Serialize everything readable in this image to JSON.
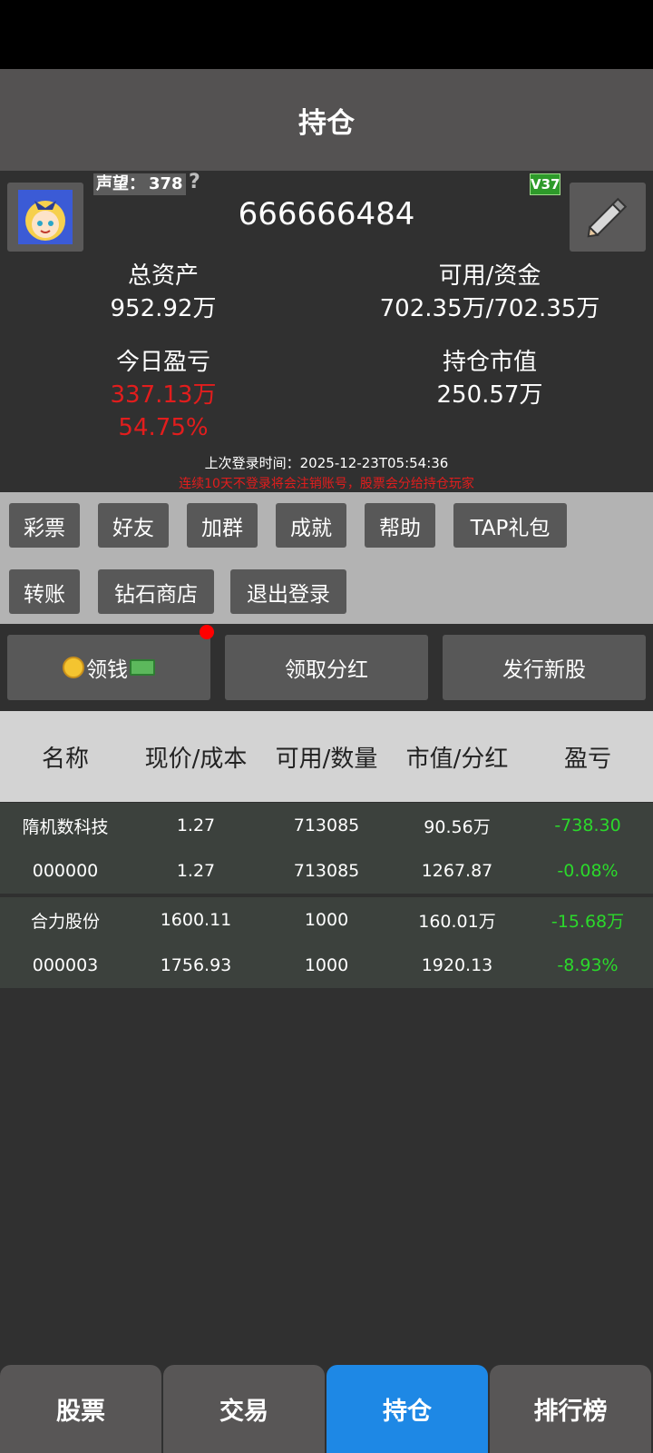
{
  "header": {
    "title": "持仓"
  },
  "account": {
    "prestige_label": "声望：",
    "prestige_value": "378",
    "help_mark": "?",
    "vip": "V37",
    "id": "666666484"
  },
  "stats": {
    "total_assets_label": "总资产",
    "total_assets": "952.92万",
    "available_label": "可用/资金",
    "available": "702.35万/702.35万",
    "today_pl_label": "今日盈亏",
    "today_pl": "337.13万",
    "today_pl_pct": "54.75%",
    "market_value_label": "持仓市值",
    "market_value": "250.57万"
  },
  "login": {
    "last_login": "上次登录时间：2025-12-23T05:54:36",
    "warning": "连续10天不登录将会注销账号，股票会分给持仓玩家"
  },
  "menu": [
    "彩票",
    "好友",
    "加群",
    "成就",
    "帮助",
    "TAP礼包",
    "转账",
    "钻石商店",
    "退出登录"
  ],
  "actions": {
    "claim_money": "领钱",
    "claim_dividend": "领取分红",
    "issue_stock": "发行新股"
  },
  "table": {
    "headers": [
      "名称",
      "现价/成本",
      "可用/数量",
      "市值/分红",
      "盈亏"
    ],
    "rows": [
      {
        "name": "隋机数科技",
        "code": "000000",
        "price": "1.27",
        "cost": "1.27",
        "available": "713085",
        "quantity": "713085",
        "market_value": "90.56万",
        "dividend": "1267.87",
        "pl": "-738.30",
        "pl_pct": "-0.08%"
      },
      {
        "name": "合力股份",
        "code": "000003",
        "price": "1600.11",
        "cost": "1756.93",
        "available": "1000",
        "quantity": "1000",
        "market_value": "160.01万",
        "dividend": "1920.13",
        "pl": "-15.68万",
        "pl_pct": "-8.93%"
      }
    ]
  },
  "tabs": [
    "股票",
    "交易",
    "持仓",
    "排行榜"
  ],
  "active_tab": "持仓",
  "colors": {
    "loss_green": "#2bd92b",
    "gain_red": "#e21d1d",
    "active_tab_blue": "#1e88e5"
  }
}
